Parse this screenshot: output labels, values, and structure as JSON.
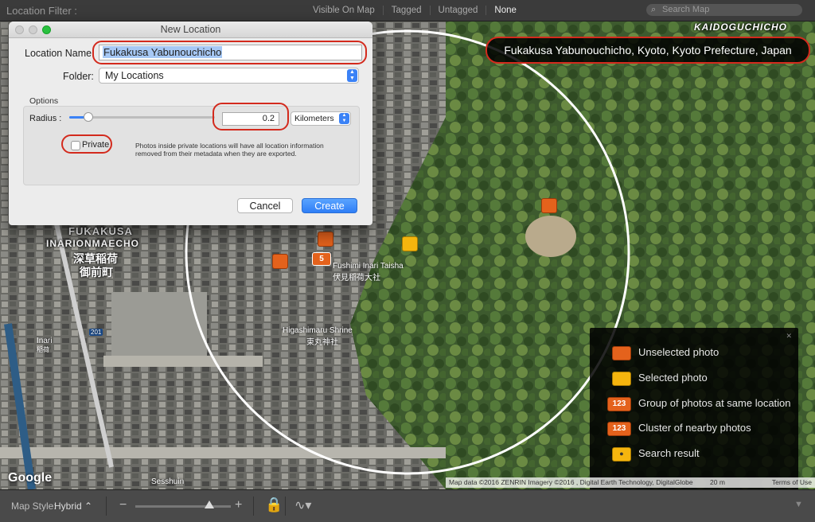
{
  "filter_bar": {
    "title": "Location Filter :",
    "filters": [
      "Visible On Map",
      "Tagged",
      "Untagged",
      "None"
    ],
    "active_filter": "None",
    "search_placeholder": "Search Map"
  },
  "dialog": {
    "title": "New Location",
    "location_name_label": "Location Name:",
    "location_name_value": "Fukakusa Yabunouchicho",
    "folder_label": "Folder:",
    "folder_value": "My Locations",
    "options_label": "Options",
    "radius_label": "Radius :",
    "radius_value": "0.2",
    "unit_value": "Kilometers",
    "private_label": "Private",
    "private_checked": false,
    "note": "Photos inside private locations will have all location information removed from their metadata when they are exported.",
    "cancel_label": "Cancel",
    "create_label": "Create"
  },
  "map": {
    "address": "Fukakusa Yabunouchicho, Kyoto, Kyoto Prefecture, Japan",
    "area_label_top": "KAIDOGUCHICHO",
    "area_label_left_1": "FUKAKUSA",
    "area_label_left_2": "INARIONMAECHO",
    "area_label_kanji_1": "深草稲荷",
    "area_label_kanji_2": "御前町",
    "shrine_1": "Fushimi Inari Taisha",
    "shrine_1_kanji": "伏見稲荷大社",
    "shrine_2": "Higashimaru Shrine",
    "shrine_2_kanji": "東丸神社",
    "station": "Inari",
    "station_kanji": "稲荷",
    "route_number": "201",
    "bottom_label": "Sesshuin",
    "cluster_count": "5",
    "google_logo": "Google",
    "attribution": "Map data ©2016 ZENRIN Imagery ©2016 , Digital Earth Technology, DigitalGlobe",
    "scale": "20 m",
    "terms": "Terms of Use",
    "marker_colors": {
      "unselected": "#e4621c",
      "selected": "#f5b50e"
    }
  },
  "legend": {
    "items": [
      {
        "icon": "orange-pin-icon",
        "label": "Unselected photo"
      },
      {
        "icon": "yellow-pin-icon",
        "label": "Selected photo"
      },
      {
        "icon": "group-count-icon",
        "count": "123",
        "label": "Group of photos at same location"
      },
      {
        "icon": "cluster-count-icon",
        "count": "123",
        "label": "Cluster of nearby photos"
      },
      {
        "icon": "search-result-icon",
        "label": "Search result"
      }
    ]
  },
  "toolbar": {
    "map_style_label": "Map Style:",
    "map_style_value": "Hybrid"
  }
}
